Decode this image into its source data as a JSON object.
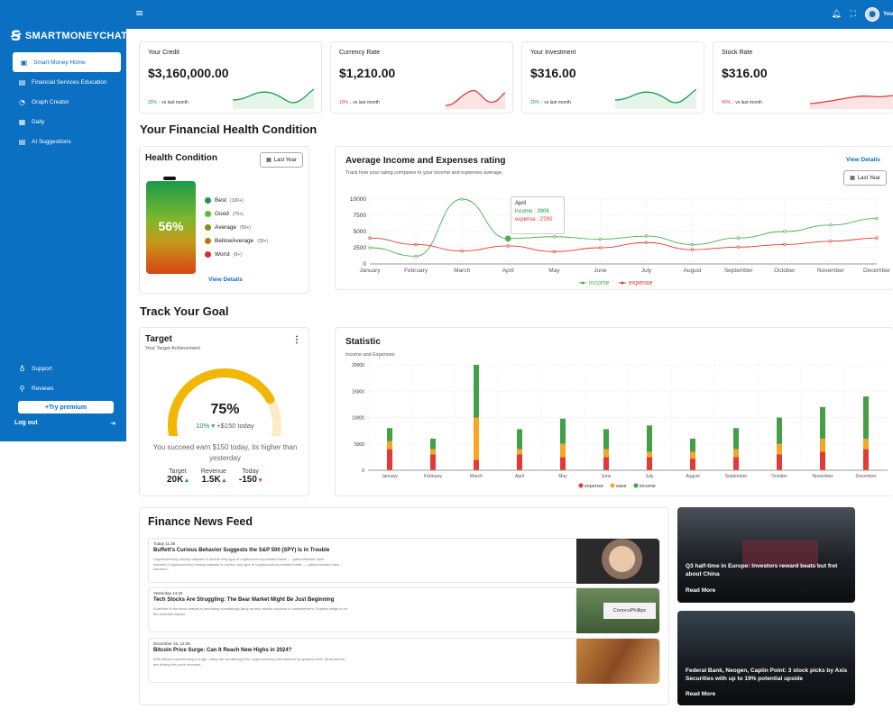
{
  "app": {
    "brand": "SMARTMONEYCHAT"
  },
  "sidebar": {
    "items": [
      {
        "label": "Smart Money Home",
        "icon": "dashboard-icon",
        "active": true
      },
      {
        "label": "Financial Services Education",
        "icon": "book-icon"
      },
      {
        "label": "Graph Creator",
        "icon": "graph-icon"
      },
      {
        "label": "Daily",
        "icon": "calendar-icon"
      },
      {
        "label": "AI Suggestions",
        "icon": "bulb-icon"
      }
    ],
    "bottom": [
      {
        "label": "Support",
        "icon": "support-icon"
      },
      {
        "label": "Reviews",
        "icon": "reviews-icon"
      }
    ],
    "premium": "+Try premium",
    "logout": "Log out"
  },
  "topbar": {
    "user": "You"
  },
  "stats": [
    {
      "title": "Your Credit",
      "value": "$3,160,000.00",
      "change": "20%",
      "direction": "up",
      "note": "vs last month",
      "color": "#1a9a4a"
    },
    {
      "title": "Currency Rate",
      "value": "$1,210.00",
      "change": "10%",
      "direction": "down",
      "note": "vs last month",
      "color": "#e53935"
    },
    {
      "title": "Your Investment",
      "value": "$316.00",
      "change": "20%",
      "direction": "up",
      "note": "vs last month",
      "color": "#1a9a4a"
    },
    {
      "title": "Stock Rate",
      "value": "$316.00",
      "change": "40%",
      "direction": "down",
      "note": "vs last month",
      "color": "#e53935"
    }
  ],
  "health_section": {
    "title": "Your Financial Health Condition"
  },
  "health": {
    "title": "Health Condition",
    "filter": "Last Year",
    "percent": "56%",
    "legend": [
      {
        "label": "Best",
        "range": "(100+)",
        "color": "#1a9a4a"
      },
      {
        "label": "Good",
        "range": "(75+)",
        "color": "#5bbf2a"
      },
      {
        "label": "Average",
        "range": "(50+)",
        "color": "#8a8a1a"
      },
      {
        "label": "BellowAverage",
        "range": "(30+)",
        "color": "#b77a12"
      },
      {
        "label": "Worst",
        "range": "(0+)",
        "color": "#d32f2f"
      }
    ],
    "view_details": "View Details"
  },
  "income_chart_card": {
    "title": "Average Income and Expenses rating",
    "subtitle": "Track how your rating compares to your income and expenses average.",
    "view_details": "View Details",
    "filter": "Last Year",
    "tooltip": {
      "month": "April",
      "income": "income : 3908",
      "expense": "expense : 2780"
    }
  },
  "goal_section": {
    "title": "Track Your Goal"
  },
  "target": {
    "title": "Target",
    "subtitle": "Your Target Achievement",
    "progress": 0.75,
    "percent": "75%",
    "change": "10%",
    "change_note": "+$150 today",
    "message": "You succeed earn $150 today, its higher than yesterday",
    "kpis": [
      {
        "label": "Target",
        "value": "20K",
        "direction": "up"
      },
      {
        "label": "Revenue",
        "value": "1.5K",
        "direction": "up"
      },
      {
        "label": "Today",
        "value": "-150",
        "direction": "down"
      }
    ]
  },
  "statistic_card": {
    "title": "Statistic",
    "subtitle": "Income and Expenses"
  },
  "chart_data": [
    {
      "type": "line",
      "categories": [
        "January",
        "February",
        "March",
        "April",
        "May",
        "June",
        "July",
        "August",
        "September",
        "October",
        "November",
        "December"
      ],
      "ylim": [
        0,
        10000
      ],
      "yticks": [
        0,
        2500,
        5000,
        7500,
        10000
      ],
      "grid": true,
      "legend": "bottom",
      "series": [
        {
          "name": "income",
          "color": "#4caf50",
          "values": [
            2500,
            1200,
            10000,
            3908,
            4200,
            3800,
            4300,
            3000,
            4000,
            5000,
            6000,
            7000
          ]
        },
        {
          "name": "expense",
          "color": "#e53935",
          "values": [
            4000,
            3000,
            2000,
            2780,
            1900,
            2500,
            3300,
            2200,
            2600,
            3000,
            3500,
            4000
          ]
        }
      ]
    },
    {
      "type": "bar",
      "stacked": true,
      "categories": [
        "January",
        "February",
        "March",
        "April",
        "May",
        "June",
        "July",
        "August",
        "September",
        "October",
        "November",
        "December"
      ],
      "ylim": [
        0,
        20000
      ],
      "yticks": [
        0,
        5000,
        10000,
        15000,
        20000
      ],
      "grid": true,
      "legend": "bottom",
      "series": [
        {
          "name": "expense",
          "color": "#e53935",
          "values": [
            4000,
            3000,
            2000,
            3000,
            2500,
            2500,
            2500,
            2200,
            2500,
            3000,
            3500,
            4000
          ]
        },
        {
          "name": "save",
          "color": "#f5a623",
          "values": [
            1500,
            1000,
            8000,
            1000,
            2500,
            1500,
            1000,
            1300,
            1500,
            2000,
            2500,
            2000
          ]
        },
        {
          "name": "income",
          "color": "#43a047",
          "values": [
            2500,
            2000,
            10000,
            3800,
            4800,
            3800,
            5000,
            2500,
            4000,
            5000,
            6000,
            8000
          ]
        }
      ]
    }
  ],
  "news": {
    "title": "Finance News Feed",
    "items": [
      {
        "date": "Today 11:36",
        "headline": "Buffett's Curious Behavior Suggests the S&P 500 (SPY) Is in Trouble",
        "desc": "Cryptocurrency-mining malware is not the only type of cryptocurrency-related threat — cybercriminals have resorted..Cryptocurrency-mining malware is not the only type of cryptocurrency-related threat — cybercriminals have resorted..."
      },
      {
        "date": "Yesterday 14:20",
        "headline": "Tech Stocks Are Struggling: The Bear Market Might Be Just Beginning",
        "desc": "A decline in the stock market is becoming increasingly likely as tech stocks continue to underperform. Experts weigh in on the potential impact...",
        "img_text": "ConocoPhillips"
      },
      {
        "date": "December 15, 12:45",
        "headline": "Bitcoin Price Surge: Can It Reach New Highs in 2024?",
        "desc": "With Bitcoin experiencing a surge, many are wondering if the cryptocurrency will continue its upward trend. What factors are driving this price increase..."
      }
    ],
    "featured": [
      {
        "headline": "Q3 half-time in Europe: Investors reward beats but fret about China",
        "more": "Read More"
      },
      {
        "headline": "Federal Bank, Neogen, Caplin Point: 3 stock picks by Axis Securities with up to 19% potential upside",
        "more": "Read More"
      }
    ]
  }
}
